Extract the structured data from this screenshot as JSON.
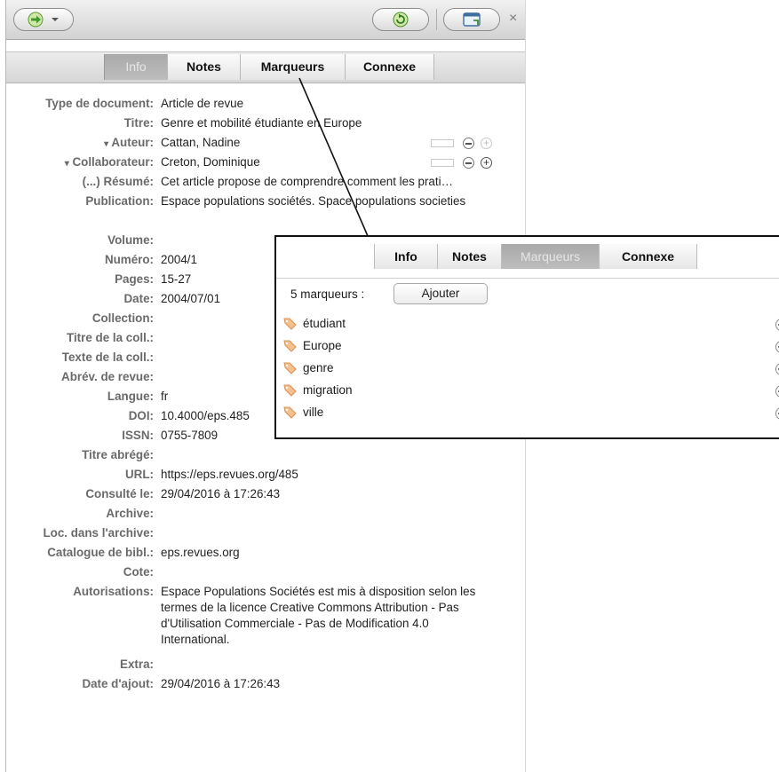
{
  "toolbar": {
    "forward_icon": "arrow-right-icon",
    "refresh_icon": "refresh-icon",
    "window_icon": "window-icon",
    "close_glyph": "×"
  },
  "tabs": [
    {
      "label": "Info",
      "selected": true
    },
    {
      "label": "Notes",
      "selected": false
    },
    {
      "label": "Marqueurs",
      "selected": false
    },
    {
      "label": "Connexe",
      "selected": false
    }
  ],
  "fields": [
    {
      "label": "Type de document:",
      "value": "Article de revue"
    },
    {
      "label": "Titre:",
      "value": "Genre et mobilité étudiante en Europe"
    },
    {
      "label": "Auteur:",
      "value": "Cattan, Nadine",
      "prefix": "▾"
    },
    {
      "label": "Collaborateur:",
      "value": "Creton, Dominique",
      "prefix": "▾"
    },
    {
      "label": "(...) Résumé:",
      "value": "Cet article propose de comprendre comment les prati…"
    },
    {
      "label": "Publication:",
      "value": "Espace populations sociétés. Space populations societies"
    },
    {
      "label": "Volume:",
      "value": ""
    },
    {
      "label": "Numéro:",
      "value": "2004/1"
    },
    {
      "label": "Pages:",
      "value": "15-27"
    },
    {
      "label": "Date:",
      "value": "2004/07/01"
    },
    {
      "label": "Collection:",
      "value": ""
    },
    {
      "label": "Titre de la coll.:",
      "value": ""
    },
    {
      "label": "Texte de la coll.:",
      "value": ""
    },
    {
      "label": "Abrév. de revue:",
      "value": ""
    },
    {
      "label": "Langue:",
      "value": "fr"
    },
    {
      "label": "DOI:",
      "value": "10.4000/eps.485"
    },
    {
      "label": "ISSN:",
      "value": "0755-7809"
    },
    {
      "label": "Titre abrégé:",
      "value": ""
    },
    {
      "label": "URL:",
      "value": "https://eps.revues.org/485"
    },
    {
      "label": "Consulté le:",
      "value": "29/04/2016 à 17:26:43"
    },
    {
      "label": "Archive:",
      "value": ""
    },
    {
      "label": "Loc. dans l'archive:",
      "value": ""
    },
    {
      "label": "Catalogue de bibl.:",
      "value": "eps.revues.org"
    },
    {
      "label": "Cote:",
      "value": ""
    },
    {
      "label": "Autorisations:",
      "value": "Espace Populations Sociétés est mis à disposition selon les termes de la licence Creative Commons Attribution - Pas d'Utilisation Commerciale - Pas de Modification 4.0 International."
    },
    {
      "label": "Extra:",
      "value": ""
    },
    {
      "label": "Date d'ajout:",
      "value": "29/04/2016 à 17:26:43"
    }
  ],
  "popup": {
    "tabs": [
      {
        "label": "Info",
        "selected": false
      },
      {
        "label": "Notes",
        "selected": false
      },
      {
        "label": "Marqueurs",
        "selected": true
      },
      {
        "label": "Connexe",
        "selected": false
      }
    ],
    "count_label": "5 marqueurs :",
    "add_button": "Ajouter",
    "tags": [
      "étudiant",
      "Europe",
      "genre",
      "migration",
      "ville"
    ],
    "tag_icon": "tag-icon",
    "remove_icon": "minus-circle-icon"
  },
  "colors": {
    "tag": "#e8a06a",
    "label": "#6a6a6a",
    "accent_green": "#3c9a2a"
  }
}
